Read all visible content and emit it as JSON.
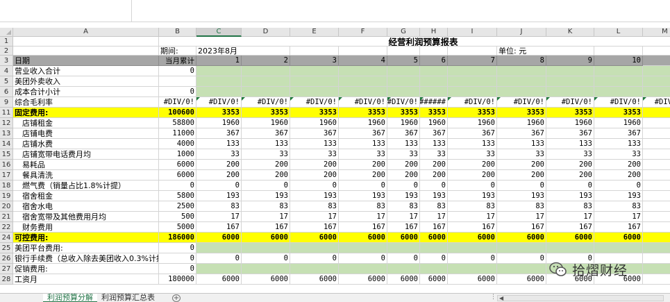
{
  "title": "经营利润预算报表",
  "period_label": "期间:",
  "period_value": "2023年8月",
  "unit_label": "单位: 元",
  "column_letters": [
    "A",
    "B",
    "C",
    "D",
    "E",
    "F",
    "G",
    "H",
    "I",
    "J",
    "K",
    "L",
    "M"
  ],
  "row_numbers": [
    "1",
    "2",
    "3",
    "4",
    "5",
    "6",
    "9",
    "11",
    "12",
    "13",
    "14",
    "15",
    "16",
    "17",
    "18",
    "19",
    "20",
    "21",
    "22",
    "24",
    "25",
    "26",
    "27",
    "28"
  ],
  "header_row": [
    "日期",
    "当月累计",
    "1",
    "2",
    "3",
    "4",
    "5",
    "6",
    "7",
    "8",
    "9",
    "10"
  ],
  "rows": [
    {
      "label": "营业收入合计",
      "b": "0",
      "vals": []
    },
    {
      "label": "美团外卖收入",
      "b": "",
      "vals": []
    },
    {
      "label": "成本合计小计",
      "b": "0",
      "vals": []
    },
    {
      "label": "综合毛利率",
      "b": "#DIV/0!",
      "vals": [
        "#DIV/0!",
        "#DIV/0!",
        "#DIV/0!",
        "#DIV/0!",
        "#DIV/0!",
        "######",
        "#DIV/0!",
        "#DIV/0!",
        "#DIV/0!",
        "#DIV/0!",
        "#DIV/0!"
      ]
    },
    {
      "label": "固定费用:",
      "b": "100600",
      "vals": [
        "3353",
        "3353",
        "3353",
        "3353",
        "3353",
        "3353",
        "3353",
        "3353",
        "3353",
        "3353",
        "3"
      ]
    },
    {
      "label": "店铺租金",
      "b": "58800",
      "vals": [
        "1960",
        "1960",
        "1960",
        "1960",
        "1960",
        "1960",
        "1960",
        "1960",
        "1960",
        "1960",
        ""
      ]
    },
    {
      "label": "店铺电费",
      "b": "11000",
      "vals": [
        "367",
        "367",
        "367",
        "367",
        "367",
        "367",
        "367",
        "367",
        "367",
        "367",
        ""
      ]
    },
    {
      "label": "店铺水费",
      "b": "4000",
      "vals": [
        "133",
        "133",
        "133",
        "133",
        "133",
        "133",
        "133",
        "133",
        "133",
        "133",
        ""
      ]
    },
    {
      "label": "店铺宽带电话费月均",
      "b": "1000",
      "vals": [
        "33",
        "33",
        "33",
        "33",
        "33",
        "33",
        "33",
        "33",
        "33",
        "33",
        ""
      ]
    },
    {
      "label": "易耗品",
      "b": "6000",
      "vals": [
        "200",
        "200",
        "200",
        "200",
        "200",
        "200",
        "200",
        "200",
        "200",
        "200",
        ""
      ]
    },
    {
      "label": "餐具清洗",
      "b": "6000",
      "vals": [
        "200",
        "200",
        "200",
        "200",
        "200",
        "200",
        "200",
        "200",
        "200",
        "200",
        ""
      ]
    },
    {
      "label": "燃气费（销量占比1.8%计提）",
      "b": "0",
      "vals": [
        "0",
        "0",
        "0",
        "0",
        "0",
        "0",
        "0",
        "0",
        "0",
        "0",
        ""
      ]
    },
    {
      "label": "宿舍租金",
      "b": "5800",
      "vals": [
        "193",
        "193",
        "193",
        "193",
        "193",
        "193",
        "193",
        "193",
        "193",
        "193",
        ""
      ]
    },
    {
      "label": "宿舍水电",
      "b": "2500",
      "vals": [
        "83",
        "83",
        "83",
        "83",
        "83",
        "83",
        "83",
        "83",
        "83",
        "83",
        ""
      ]
    },
    {
      "label": "宿舍宽带及其他费用月均",
      "b": "500",
      "vals": [
        "17",
        "17",
        "17",
        "17",
        "17",
        "17",
        "17",
        "17",
        "17",
        "17",
        ""
      ]
    },
    {
      "label": "财务费用",
      "b": "5000",
      "vals": [
        "167",
        "167",
        "167",
        "167",
        "167",
        "167",
        "167",
        "167",
        "167",
        "167",
        ""
      ]
    },
    {
      "label": "可控费用:",
      "b": "186000",
      "vals": [
        "6000",
        "6000",
        "6000",
        "6000",
        "6000",
        "6000",
        "6000",
        "6000",
        "6000",
        "6000",
        "6"
      ]
    },
    {
      "label": "美团平台费用:",
      "b": "0",
      "vals": []
    },
    {
      "label": "银行手续费（总收入除去美团收入0.3%计提",
      "b": "0",
      "vals": [
        "0",
        "0",
        "0",
        "0",
        "0",
        "0",
        "0",
        "0",
        "0",
        "",
        ""
      ]
    },
    {
      "label": "促销费用:",
      "b": "0",
      "vals": []
    },
    {
      "label": "工资月",
      "b": "180000",
      "vals": [
        "6000",
        "6000",
        "6000",
        "6000",
        "6000",
        "6000",
        "6000",
        "6000",
        "6000",
        "6000",
        ""
      ]
    }
  ],
  "tabs": [
    "利润预算分解",
    "利润预算汇总表"
  ],
  "watermark_text": "拾熠财经",
  "colors": {
    "yellow": "#ffff00",
    "green": "#c6e0b4",
    "gray": "#a6a6a6",
    "accent": "#217346"
  }
}
